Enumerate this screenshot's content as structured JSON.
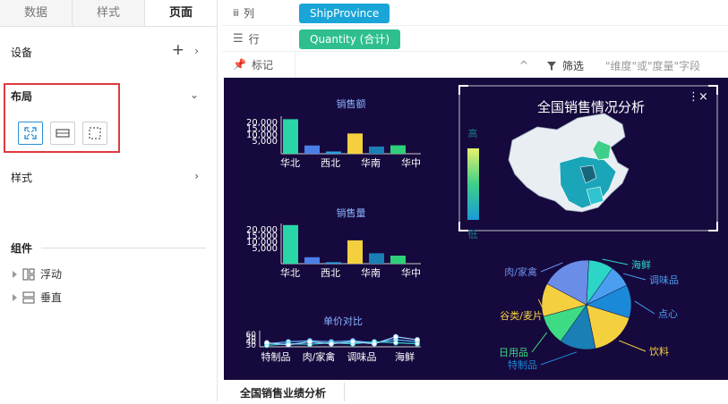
{
  "tabs": [
    "数据",
    "样式",
    "页面"
  ],
  "sidebar": {
    "device_label": "设备",
    "layout_label": "布局",
    "style_label": "样式",
    "components_label": "组件",
    "components": [
      "浮动",
      "垂直"
    ]
  },
  "shelves": {
    "columns_label": "列",
    "columns_field": "ShipProvince",
    "rows_label": "行",
    "rows_field": "Quantity (合计)",
    "marks_label": "标记",
    "filter_label": "筛选",
    "filter_hint": "\"维度\"或\"度量\"字段"
  },
  "colors": {
    "columns_pill": "#1aa5d8",
    "rows_pill": "#2fbf8e",
    "canvas_bg": "#16093d",
    "highlight": "#e0393e"
  },
  "dashboard": {
    "title": "全国销售情况分析",
    "legend_high": "高",
    "legend_low": "低",
    "bottom_tab": "全国销售业绩分析"
  },
  "chart_data": [
    {
      "type": "bar",
      "title": "销售额",
      "categories": [
        "华北",
        "西北",
        "华南",
        "华中"
      ],
      "tick_labels": [
        "20,000",
        "15,000",
        "10,000",
        "5,000"
      ],
      "values": [
        23000,
        5500,
        1500,
        13500,
        4800,
        5600
      ],
      "colors": [
        "#2bd6a6",
        "#4a7fe8",
        "#2aa0e0",
        "#f4d03f",
        "#1a7fb5",
        "#2fcf79"
      ]
    },
    {
      "type": "bar",
      "title": "销售量",
      "categories": [
        "华北",
        "西北",
        "华南",
        "华中"
      ],
      "tick_labels": [
        "20,000",
        "15,000",
        "10,000",
        "5,000"
      ],
      "values": [
        24000,
        4000,
        900,
        14500,
        6500,
        5000
      ],
      "colors": [
        "#2bd6a6",
        "#4a7fe8",
        "#2aa0e0",
        "#f4d03f",
        "#1a7fb5",
        "#2fcf79"
      ]
    },
    {
      "type": "line",
      "title": "单价对比",
      "categories": [
        "特制品",
        "肉/家禽",
        "调味品",
        "海鲜"
      ],
      "tick_labels": [
        "60",
        "50",
        "40",
        "30"
      ],
      "series": [
        {
          "values": [
            36,
            40,
            42,
            40,
            42,
            38,
            44,
            40
          ]
        },
        {
          "values": [
            33,
            36,
            35,
            38,
            36,
            40,
            38,
            36
          ]
        },
        {
          "values": [
            38,
            34,
            40,
            36,
            40,
            36,
            50,
            44
          ]
        }
      ]
    },
    {
      "type": "pie",
      "categories": [
        "海鲜",
        "调味品",
        "点心",
        "饮料",
        "特制品",
        "日用品",
        "谷类/麦片",
        "肉/家禽"
      ],
      "values": [
        9,
        8,
        12,
        17,
        13,
        11,
        12,
        18
      ],
      "colors": [
        "#2bd6c6",
        "#4a9ff0",
        "#1a8ad8",
        "#f4d03f",
        "#1a7fb5",
        "#3ddc84",
        "#f4d03f",
        "#6a8ee8"
      ]
    }
  ]
}
